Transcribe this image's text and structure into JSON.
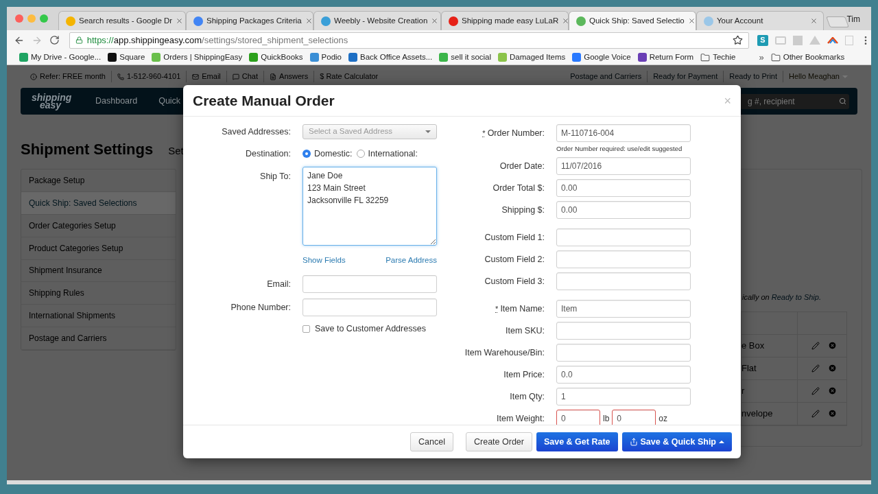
{
  "browser": {
    "tabs": [
      {
        "title": "Search results - Google Dr",
        "selected": false
      },
      {
        "title": "Shipping Packages Criteria",
        "selected": false
      },
      {
        "title": "Weebly - Website Creation",
        "selected": false
      },
      {
        "title": "Shipping made easy LuLaR",
        "selected": false
      },
      {
        "title": "Quick Ship: Saved Selectio",
        "selected": true
      },
      {
        "title": "Your Account",
        "selected": false
      }
    ],
    "profile": "Tim",
    "url": {
      "scheme": "https://",
      "host": "app.shippingeasy.com",
      "path": "/settings/stored_shipment_selections"
    },
    "extension_badge": "S",
    "bookmarks": [
      {
        "label": "My Drive - Google...",
        "kind": "site"
      },
      {
        "label": "Square",
        "kind": "site"
      },
      {
        "label": "Orders | ShippingEasy",
        "kind": "site"
      },
      {
        "label": "QuickBooks",
        "kind": "site"
      },
      {
        "label": "Podio",
        "kind": "site"
      },
      {
        "label": "Back Office Assets...",
        "kind": "site"
      },
      {
        "label": "sell it social",
        "kind": "site"
      },
      {
        "label": "Damaged Items",
        "kind": "site"
      },
      {
        "label": "Google Voice",
        "kind": "site"
      },
      {
        "label": "Return Form",
        "kind": "site"
      },
      {
        "label": "Techie",
        "kind": "folder"
      }
    ],
    "overflow": "»",
    "other_bookmarks": {
      "label": "Other Bookmarks",
      "kind": "folder"
    }
  },
  "app": {
    "util_left": [
      "Refer: FREE month",
      "1-512-960-4101",
      "Email",
      "Chat",
      "Answers",
      "$ Rate Calculator"
    ],
    "util_right": [
      "Postage and Carriers",
      "Ready for Payment",
      "Ready to Print",
      "Hello Meaghan"
    ],
    "logo": [
      "shipping",
      "easy"
    ],
    "nav": [
      "Dashboard",
      "Quick"
    ],
    "search_placeholder": "g #, recipient",
    "heading": "Shipment Settings",
    "heading_tab": "Set",
    "menu": [
      {
        "label": "Package Setup",
        "selected": false
      },
      {
        "label": "Quick Ship: Saved Selections",
        "selected": true
      },
      {
        "label": "Order Categories Setup",
        "selected": false
      },
      {
        "label": "Product Categories Setup",
        "selected": false
      },
      {
        "label": "Shipment Insurance",
        "selected": false
      },
      {
        "label": "Shipping Rules",
        "selected": false
      },
      {
        "label": "International Shipments",
        "selected": false
      },
      {
        "label": "Postage and Carriers",
        "selected": false
      }
    ],
    "note": {
      "text": "ically on",
      "link": "Ready to Ship."
    },
    "rows": [
      "e Box",
      "Flat",
      "r",
      "nvelope"
    ]
  },
  "modal": {
    "title": "Create Manual Order",
    "close": "×",
    "saved_addresses": {
      "label": "Saved Addresses:",
      "placeholder": "Select a Saved Address"
    },
    "destination": {
      "label": "Destination:",
      "options": [
        {
          "label": "Domestic:",
          "selected": true
        },
        {
          "label": "International:",
          "selected": false
        }
      ]
    },
    "ship_to": {
      "label": "Ship To:",
      "lines": [
        "Jane Doe",
        "123 Main Street",
        "Jacksonville FL 32259"
      ]
    },
    "address_links": [
      "Show Fields",
      "Parse Address"
    ],
    "email": {
      "label": "Email:"
    },
    "phone": {
      "label": "Phone Number:"
    },
    "save_address": {
      "label": "Save to Customer Addresses",
      "checked": false
    },
    "groups": [
      {
        "fields": [
          {
            "kind": "text",
            "label": "Order Number:",
            "required_mark": "*",
            "value": "M-110716-004",
            "hint": "Order Number required: use/edit suggested"
          },
          {
            "kind": "text",
            "label": "Order Date:",
            "value": "11/07/2016"
          },
          {
            "kind": "text",
            "label": "Order Total $:",
            "value": "0.00"
          },
          {
            "kind": "text",
            "label": "Shipping $:",
            "value": "0.00"
          }
        ]
      },
      {
        "fields": [
          {
            "kind": "text",
            "label": "Custom Field 1:"
          },
          {
            "kind": "text",
            "label": "Custom Field 2:"
          },
          {
            "kind": "text",
            "label": "Custom Field 3:"
          }
        ]
      },
      {
        "fields": [
          {
            "kind": "text",
            "label": "Item Name:",
            "required_mark": "*",
            "value": "Item"
          },
          {
            "kind": "text",
            "label": "Item SKU:"
          },
          {
            "kind": "text",
            "label": "Item Warehouse/Bin:"
          },
          {
            "kind": "text",
            "label": "Item Price:",
            "value": "0.0"
          },
          {
            "kind": "text",
            "label": "Item Qty:",
            "value": "1"
          },
          {
            "kind": "weight",
            "label": "Item Weight:",
            "invalid": true,
            "lb": "0",
            "lb_unit": "lb",
            "oz": "0",
            "oz_unit": "oz"
          }
        ]
      }
    ],
    "buttons": [
      {
        "label": "Cancel",
        "kind": "default"
      },
      {
        "label": "Create Order",
        "kind": "default"
      },
      {
        "label": "Save & Get Rate",
        "kind": "primary"
      },
      {
        "label": "Save & Quick Ship",
        "kind": "menu"
      }
    ]
  }
}
